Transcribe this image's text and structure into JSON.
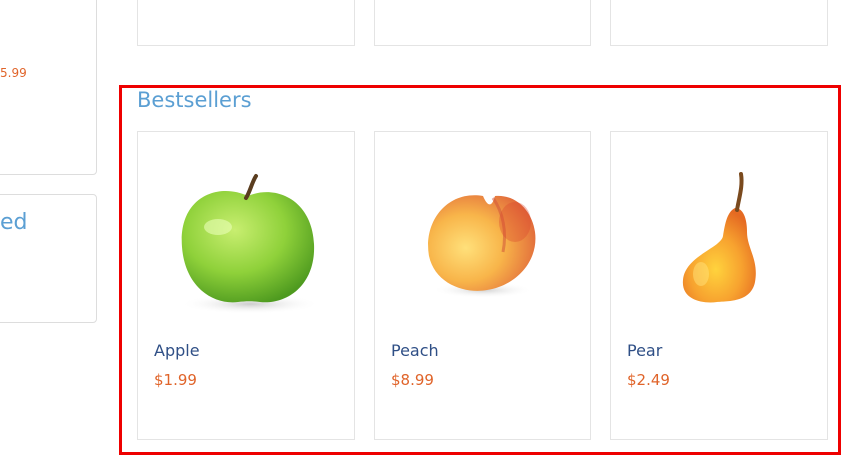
{
  "sidebar": {
    "partial_price": "5.99",
    "partial_heading": "ed"
  },
  "bestsellers": {
    "title": "Bestsellers",
    "products": [
      {
        "name": "Apple",
        "price": "$1.99",
        "icon": "apple-image"
      },
      {
        "name": "Peach",
        "price": "$8.99",
        "icon": "peach-image"
      },
      {
        "name": "Pear",
        "price": "$2.49",
        "icon": "pear-image"
      }
    ]
  },
  "colors": {
    "highlight": "#ee0000",
    "heading": "#5b9fd3",
    "product_name": "#2f4f86",
    "price": "#e0642a"
  }
}
